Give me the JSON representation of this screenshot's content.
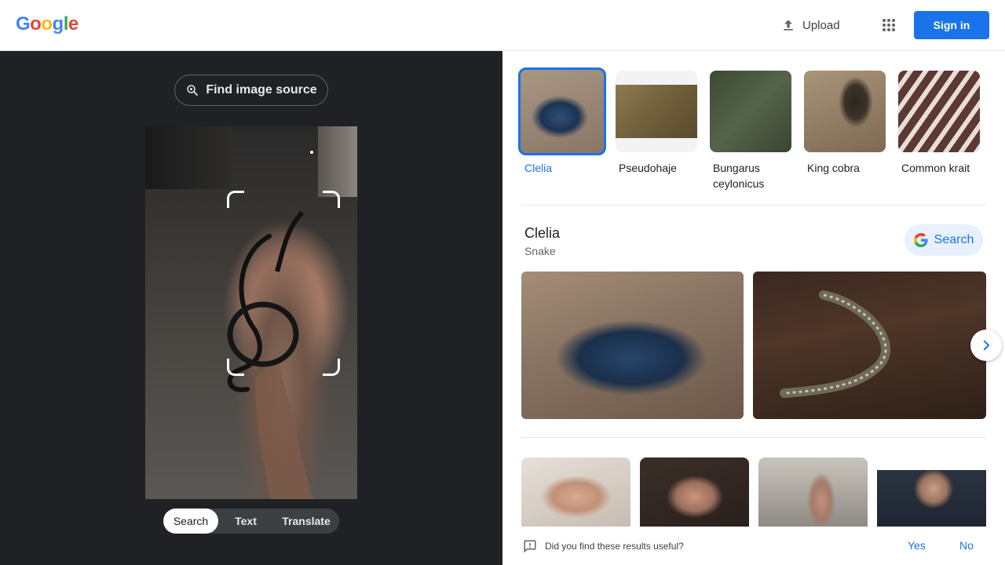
{
  "header": {
    "logo_letters": [
      "G",
      "o",
      "o",
      "g",
      "l",
      "e"
    ],
    "logo_colors": [
      "#4285f4",
      "#ea4335",
      "#fbbc05",
      "#4285f4",
      "#34a853",
      "#ea4335"
    ],
    "upload_label": "Upload",
    "signin_label": "Sign in"
  },
  "left": {
    "find_source_label": "Find image source",
    "mode_tabs": [
      "Search",
      "Text",
      "Translate"
    ],
    "active_tab": "Search"
  },
  "results": {
    "thumbnails": [
      {
        "label": "Clelia",
        "icon": "snake-image",
        "selected": true
      },
      {
        "label": "Pseudohaje",
        "icon": "snake-image"
      },
      {
        "label": "Bungarus ceylonicus",
        "icon": "snake-image"
      },
      {
        "label": "King cobra",
        "icon": "snake-image"
      },
      {
        "label": "Common krait",
        "icon": "snake-image"
      }
    ],
    "entity_title": "Clelia",
    "entity_subtitle": "Snake",
    "entity_search_label": "Search"
  },
  "feedback": {
    "question": "Did you find these results useful?",
    "yes_label": "Yes",
    "no_label": "No"
  },
  "colors": {
    "accent": "#1a73e8",
    "dark_pane": "#202124"
  }
}
